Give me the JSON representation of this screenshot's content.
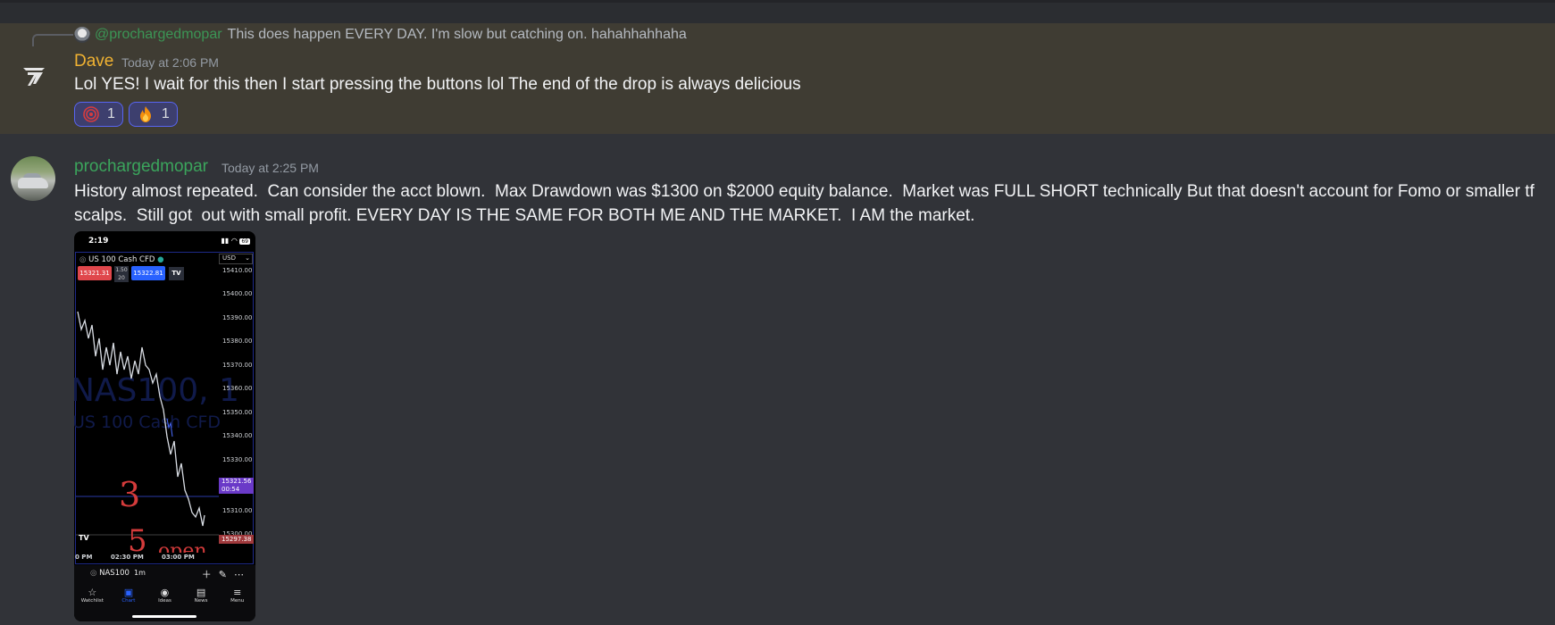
{
  "message1": {
    "reply": {
      "author": "@prochargedmopar",
      "text": "This does happen EVERY DAY. I'm slow but catching on. hahahhahhaha"
    },
    "author": "Dave",
    "author_color": "#f0b232",
    "timestamp": "Today at 2:06 PM",
    "text": "Lol YES! I wait for this then I start pressing the buttons lol The end of the drop is always delicious",
    "reactions": [
      {
        "emoji": "red-spiral-icon",
        "count": "1"
      },
      {
        "emoji": "fire-icon",
        "count": "1"
      }
    ]
  },
  "message2": {
    "author": "prochargedmopar",
    "author_color": "#3ba55c",
    "timestamp": "Today at 2:25 PM",
    "text": "History almost repeated.  Can consider the acct blown.  Max Drawdown was $1300 on $2000 equity balance.  Market was FULL SHORT technically But that doesn't account for Fomo or smaller tf scalps.  Still got  out with small profit. EVERY DAY IS THE SAME FOR BOTH ME AND THE MARKET.  I AM the market."
  },
  "attachment": {
    "status_time": "2:19",
    "battery": "69",
    "symbol_title": "US 100 Cash CFD",
    "currency": "USD",
    "sell_price": "15321.31",
    "lot_top": "1.50",
    "lot_bottom": "20",
    "buy_price": "15322.81",
    "tv_logo": "TV",
    "y_ticks": [
      "15410.00",
      "15400.00",
      "15390.00",
      "15380.00",
      "15370.00",
      "15360.00",
      "15350.00",
      "15340.00",
      "15330.00",
      "15321.56",
      "15310.00",
      "15300.00"
    ],
    "price_tag": "15321.56",
    "price_tag_sub": "00:54",
    "low_tag": "15297.38",
    "watermark_1": "NAS100, 1",
    "watermark_2": "US 100 Cash CFD",
    "x_ticks": [
      "0 PM",
      "02:30 PM",
      "03:00 PM"
    ],
    "handwriting": [
      "3",
      "5",
      "open"
    ],
    "symbol": "NAS100",
    "timeframe": "1m",
    "nav": [
      {
        "label": "Watchlist",
        "icon": "star-icon"
      },
      {
        "label": "Chart",
        "icon": "chart-icon"
      },
      {
        "label": "Ideas",
        "icon": "bulb-icon"
      },
      {
        "label": "News",
        "icon": "news-icon"
      },
      {
        "label": "Menu",
        "icon": "menu-icon"
      }
    ]
  }
}
